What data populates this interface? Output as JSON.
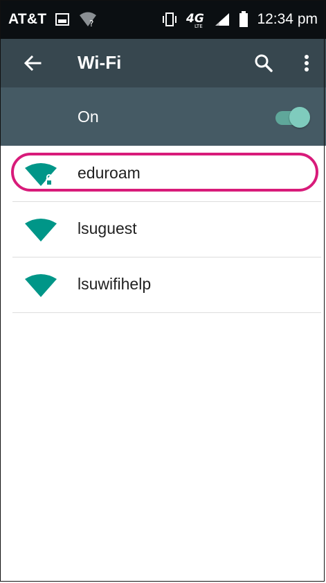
{
  "status_bar": {
    "carrier": "AT&T",
    "time": "12:34 pm",
    "icons": [
      "image-icon",
      "wifi-unknown-icon",
      "vibrate-icon",
      "4g-lte-icon",
      "signal-icon",
      "battery-icon"
    ]
  },
  "app_bar": {
    "title": "Wi-Fi",
    "icons": [
      "back-arrow-icon",
      "search-icon",
      "more-vert-icon"
    ]
  },
  "wifi_toggle": {
    "label": "On",
    "enabled": true
  },
  "networks": [
    {
      "name": "eduroam",
      "secured": true,
      "highlighted": true
    },
    {
      "name": "lsuguest",
      "secured": false,
      "highlighted": false
    },
    {
      "name": "lsuwifihelp",
      "secured": false,
      "highlighted": false
    }
  ],
  "colors": {
    "status_bar": "#0b0f12",
    "app_bar": "#37474f",
    "toggle_bar": "#455a64",
    "accent": "#009688",
    "switch_thumb": "#7fcbbd",
    "highlight": "#d81b7a"
  }
}
